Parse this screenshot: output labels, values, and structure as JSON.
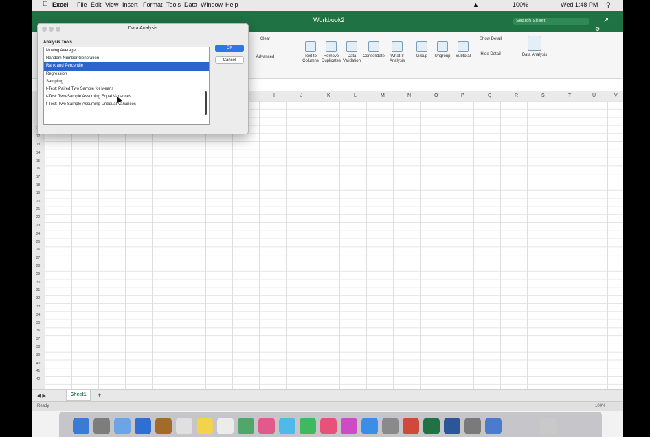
{
  "menubar": {
    "app": "Excel",
    "items": [
      "File",
      "Edit",
      "View",
      "Insert",
      "Format",
      "Tools",
      "Data",
      "Window",
      "Help"
    ],
    "battery": "100%",
    "clock": "Wed 1:48 PM"
  },
  "window": {
    "title": "Workbook2",
    "search_placeholder": "Search Sheet",
    "share_icon": "share-icon"
  },
  "ribbon": {
    "buttons": [
      "Text to Columns",
      "Remove Duplicates",
      "Data Validation",
      "Consolidate",
      "What-If Analysis",
      "Group",
      "Ungroup",
      "Subtotal",
      "Data Analysis"
    ],
    "small": [
      "Clear",
      "Advanced",
      "Show Detail",
      "Hide Detail"
    ]
  },
  "columns": [
    "I",
    "J",
    "K",
    "L",
    "M",
    "N",
    "O",
    "P",
    "Q",
    "R",
    "S",
    "T",
    "U",
    "V"
  ],
  "rows": [
    "8",
    "9",
    "10",
    "11",
    "12",
    "13",
    "14",
    "15",
    "16",
    "17",
    "18",
    "19",
    "20",
    "21",
    "22",
    "23",
    "24",
    "25",
    "26",
    "27",
    "28",
    "29",
    "30",
    "31",
    "32",
    "33",
    "34",
    "35",
    "36",
    "37",
    "38",
    "39",
    "40",
    "41",
    "42"
  ],
  "dialog": {
    "title": "Data Analysis",
    "label": "Analysis Tools",
    "items": [
      "Moving Average",
      "Random Number Generation",
      "Rank and Percentile",
      "Regression",
      "Sampling",
      "t-Test: Paired Two Sample for Means",
      "t-Test: Two-Sample Assuming Equal Variances",
      "t-Test: Two-Sample Assuming Unequal Variances"
    ],
    "selected_index": 2,
    "ok_label": "OK",
    "cancel_label": "Cancel"
  },
  "sheet": {
    "tab": "Sheet1",
    "add": "+",
    "nav": "◀ ▶"
  },
  "status": {
    "ready": "Ready",
    "zoom": "100%"
  },
  "colors": {
    "excel_green": "#1f7244",
    "selection_blue": "#2b63d1",
    "ok_blue": "#2f77e6"
  }
}
